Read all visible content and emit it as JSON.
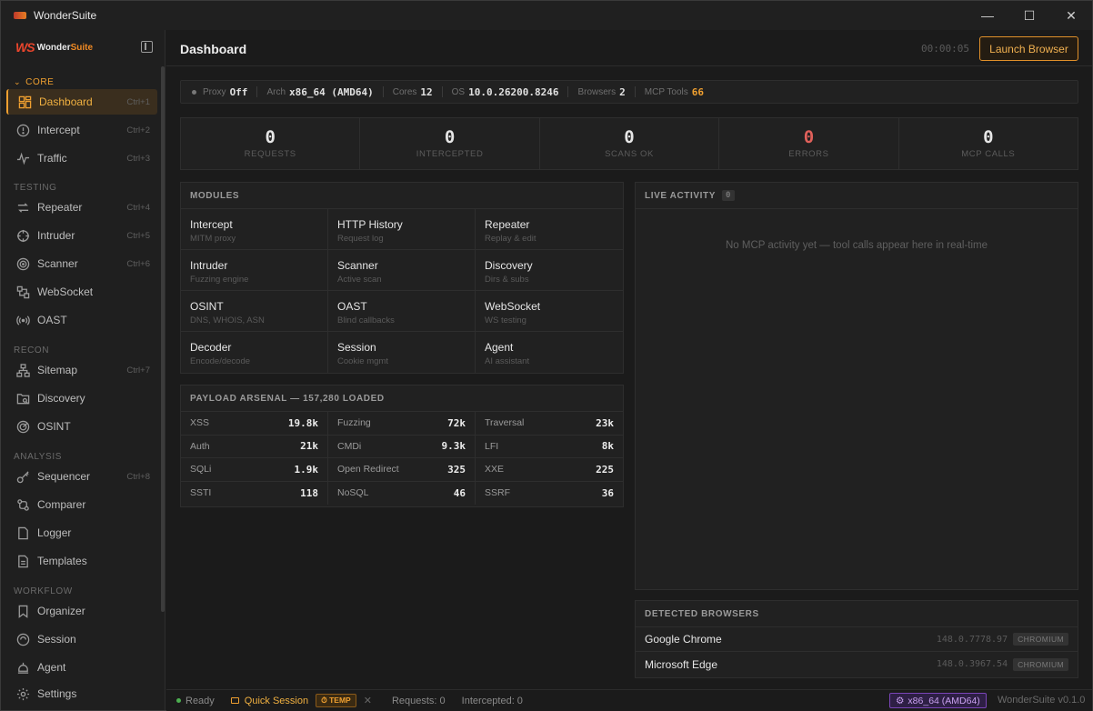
{
  "window": {
    "title": "WonderSuite",
    "minimize": "—",
    "maximize": "☐",
    "close": "✕"
  },
  "logo": {
    "mark": "WS",
    "word1": "Wonder",
    "word2": "Suite"
  },
  "sidebar": {
    "sections": [
      {
        "key": "core",
        "label": "CORE",
        "items": [
          {
            "label": "Dashboard",
            "shortcut": "Ctrl+1",
            "icon": "dashboard-icon",
            "active": true
          },
          {
            "label": "Intercept",
            "shortcut": "Ctrl+2",
            "icon": "intercept-icon"
          },
          {
            "label": "Traffic",
            "shortcut": "Ctrl+3",
            "icon": "traffic-icon"
          }
        ]
      },
      {
        "key": "testing",
        "label": "TESTING",
        "items": [
          {
            "label": "Repeater",
            "shortcut": "Ctrl+4",
            "icon": "repeat-icon"
          },
          {
            "label": "Intruder",
            "shortcut": "Ctrl+5",
            "icon": "crosshair-icon"
          },
          {
            "label": "Scanner",
            "shortcut": "Ctrl+6",
            "icon": "scanner-icon"
          },
          {
            "label": "WebSocket",
            "shortcut": "",
            "icon": "websocket-icon"
          },
          {
            "label": "OAST",
            "shortcut": "",
            "icon": "broadcast-icon"
          }
        ]
      },
      {
        "key": "recon",
        "label": "RECON",
        "items": [
          {
            "label": "Sitemap",
            "shortcut": "Ctrl+7",
            "icon": "sitemap-icon"
          },
          {
            "label": "Discovery",
            "shortcut": "",
            "icon": "folder-search-icon"
          },
          {
            "label": "OSINT",
            "shortcut": "",
            "icon": "radar-icon"
          }
        ]
      },
      {
        "key": "analysis",
        "label": "ANALYSIS",
        "items": [
          {
            "label": "Sequencer",
            "shortcut": "Ctrl+8",
            "icon": "key-icon"
          },
          {
            "label": "Comparer",
            "shortcut": "",
            "icon": "compare-icon"
          },
          {
            "label": "Logger",
            "shortcut": "",
            "icon": "document-icon"
          },
          {
            "label": "Templates",
            "shortcut": "",
            "icon": "template-icon"
          }
        ]
      },
      {
        "key": "workflow",
        "label": "WORKFLOW",
        "items": [
          {
            "label": "Organizer",
            "shortcut": "",
            "icon": "bookmark-icon"
          },
          {
            "label": "Session",
            "shortcut": "",
            "icon": "session-icon"
          },
          {
            "label": "Agent",
            "shortcut": "",
            "icon": "agent-icon"
          }
        ]
      }
    ],
    "settings": {
      "label": "Settings",
      "icon": "gear-icon"
    }
  },
  "header": {
    "title": "Dashboard",
    "timer": "00:00:05",
    "launch_label": "Launch Browser"
  },
  "sysbar": {
    "proxy_k": "Proxy",
    "proxy_v": "Off",
    "arch_k": "Arch",
    "arch_v": "x86_64 (AMD64)",
    "cores_k": "Cores",
    "cores_v": "12",
    "os_k": "OS",
    "os_v": "10.0.26200.8246",
    "browsers_k": "Browsers",
    "browsers_v": "2",
    "mcp_k": "MCP Tools",
    "mcp_v": "66",
    "mcp_color": "#f0a030"
  },
  "stats": [
    {
      "value": "0",
      "label": "REQUESTS"
    },
    {
      "value": "0",
      "label": "INTERCEPTED"
    },
    {
      "value": "0",
      "label": "SCANS OK"
    },
    {
      "value": "0",
      "label": "ERRORS",
      "color": "#e0605a"
    },
    {
      "value": "0",
      "label": "MCP CALLS"
    }
  ],
  "modules": {
    "title": "MODULES",
    "items": [
      {
        "name": "Intercept",
        "desc": "MITM proxy"
      },
      {
        "name": "HTTP History",
        "desc": "Request log"
      },
      {
        "name": "Repeater",
        "desc": "Replay & edit"
      },
      {
        "name": "Intruder",
        "desc": "Fuzzing engine"
      },
      {
        "name": "Scanner",
        "desc": "Active scan"
      },
      {
        "name": "Discovery",
        "desc": "Dirs & subs"
      },
      {
        "name": "OSINT",
        "desc": "DNS, WHOIS, ASN"
      },
      {
        "name": "OAST",
        "desc": "Blind callbacks"
      },
      {
        "name": "WebSocket",
        "desc": "WS testing"
      },
      {
        "name": "Decoder",
        "desc": "Encode/decode"
      },
      {
        "name": "Session",
        "desc": "Cookie mgmt"
      },
      {
        "name": "Agent",
        "desc": "AI assistant"
      }
    ]
  },
  "payloads": {
    "title": "PAYLOAD ARSENAL — 157,280 LOADED",
    "items": [
      {
        "name": "XSS",
        "count": "19.8k"
      },
      {
        "name": "Fuzzing",
        "count": "72k"
      },
      {
        "name": "Traversal",
        "count": "23k"
      },
      {
        "name": "Auth",
        "count": "21k"
      },
      {
        "name": "CMDi",
        "count": "9.3k"
      },
      {
        "name": "LFI",
        "count": "8k"
      },
      {
        "name": "SQLi",
        "count": "1.9k"
      },
      {
        "name": "Open Redirect",
        "count": "325"
      },
      {
        "name": "XXE",
        "count": "225"
      },
      {
        "name": "SSTI",
        "count": "118"
      },
      {
        "name": "NoSQL",
        "count": "46"
      },
      {
        "name": "SSRF",
        "count": "36"
      }
    ]
  },
  "activity": {
    "title": "LIVE ACTIVITY",
    "count": "0",
    "empty": "No MCP activity yet — tool calls appear here in real-time"
  },
  "browsers": {
    "title": "DETECTED BROWSERS",
    "items": [
      {
        "name": "Google Chrome",
        "version": "148.0.7778.97",
        "tag": "CHROMIUM"
      },
      {
        "name": "Microsoft Edge",
        "version": "148.0.3967.54",
        "tag": "CHROMIUM"
      }
    ]
  },
  "status": {
    "ready": "Ready",
    "session": "Quick Session",
    "temp": "TEMP",
    "close": "✕",
    "requests": "Requests: 0",
    "intercepted": "Intercepted: 0",
    "arch": "x86_64 (AMD64)",
    "version": "WonderSuite v0.1.0"
  }
}
